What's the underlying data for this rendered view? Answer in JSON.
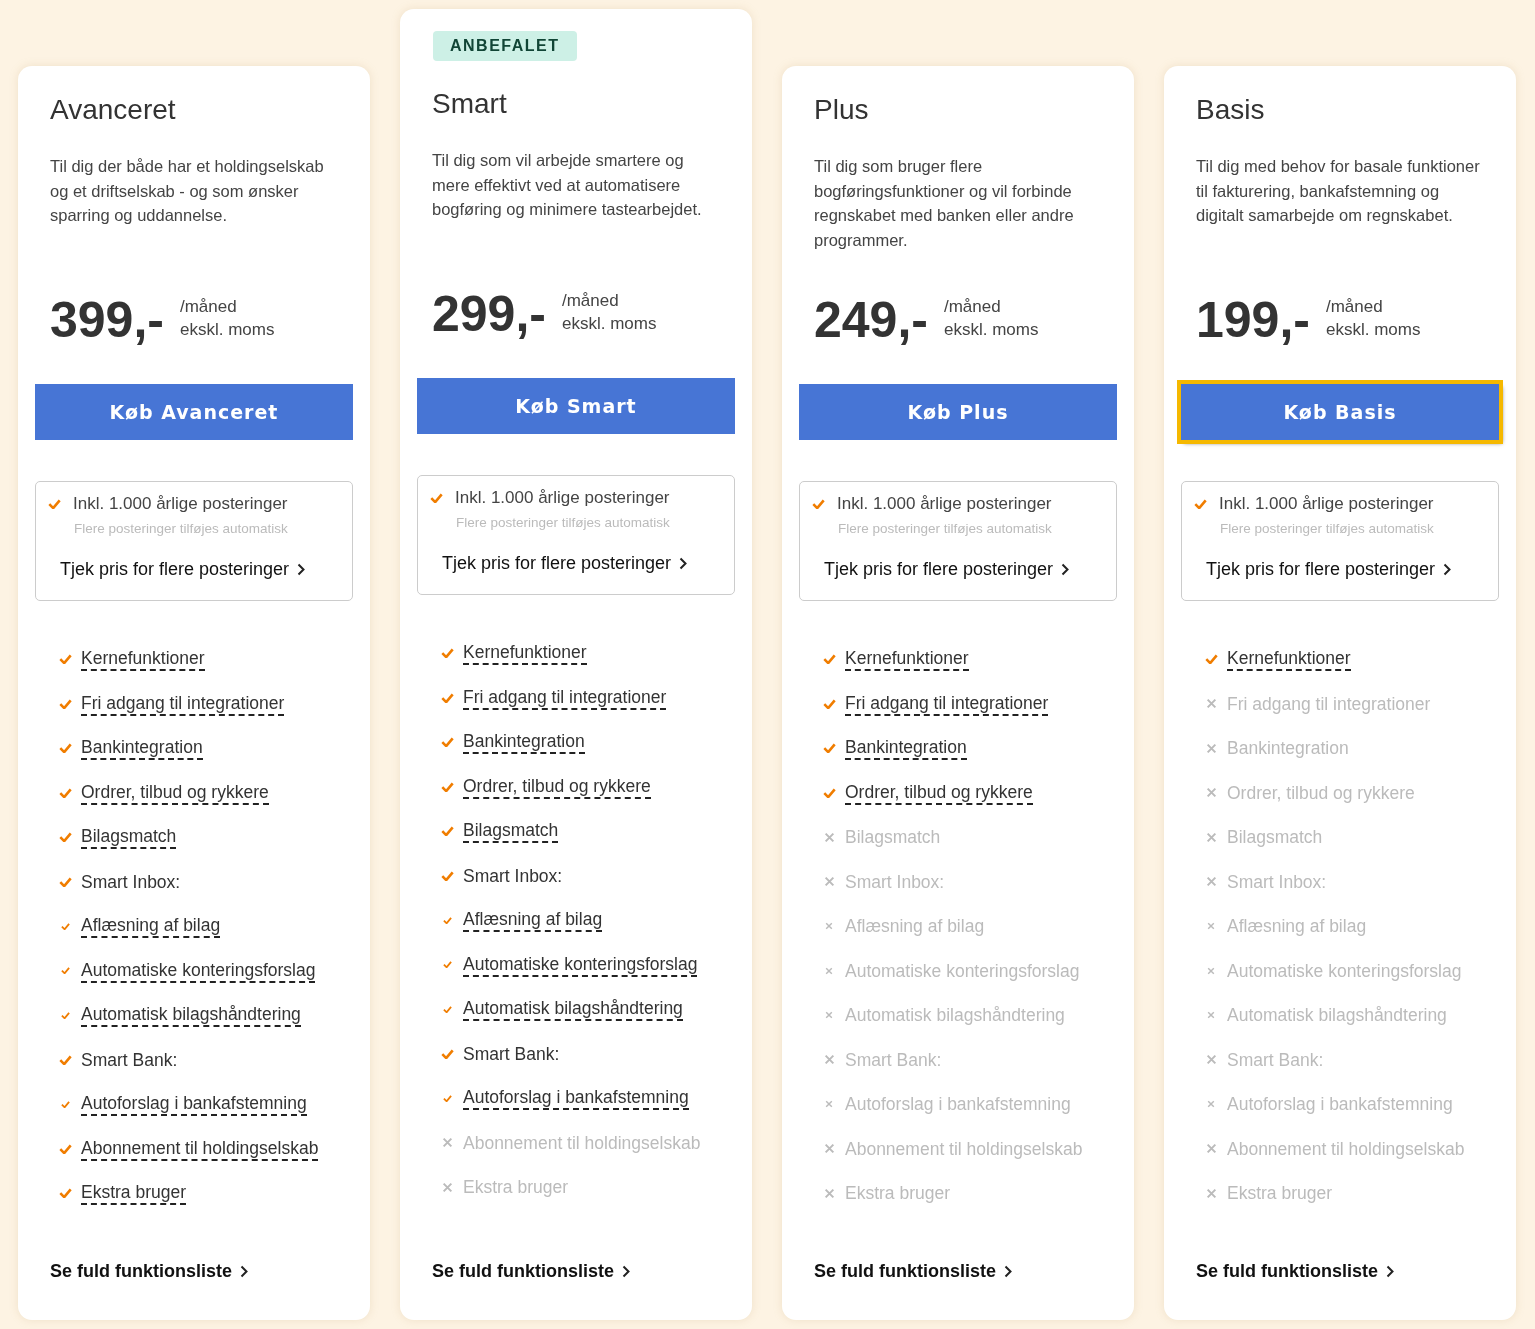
{
  "plans": [
    {
      "name": "Avanceret",
      "recommended": false,
      "description": "Til dig der både har et holdingselskab og et driftselskab - og som ønsker sparring og uddannelse.",
      "price": "399,-",
      "period": "/måned",
      "vat_note": "ekskl. moms",
      "buy_button": {
        "label": "Køb Avanceret",
        "focused": false
      },
      "postings": {
        "title": "Inkl. 1.000 årlige posteringer",
        "note": "Flere posteringer tilføjes automatisk",
        "link": "Tjek pris for flere posteringer"
      },
      "features": [
        {
          "label": "Kernefunktioner",
          "included": true,
          "tooltip": true
        },
        {
          "label": "Fri adgang til integrationer",
          "included": true,
          "tooltip": true
        },
        {
          "label": "Bankintegration",
          "included": true,
          "tooltip": true
        },
        {
          "label": "Ordrer, tilbud og rykkere",
          "included": true,
          "tooltip": true
        },
        {
          "label": "Bilagsmatch",
          "included": true,
          "tooltip": true
        },
        {
          "label": "Smart Inbox:",
          "included": true,
          "tooltip": false,
          "children": [
            {
              "label": "Aflæsning af bilag",
              "included": true,
              "tooltip": true
            },
            {
              "label": "Automatiske konteringsforslag",
              "included": true,
              "tooltip": true
            },
            {
              "label": "Automatisk bilagshåndtering",
              "included": true,
              "tooltip": true
            }
          ]
        },
        {
          "label": "Smart Bank:",
          "included": true,
          "tooltip": false,
          "children": [
            {
              "label": "Autoforslag i bankafstemning",
              "included": true,
              "tooltip": true
            }
          ]
        },
        {
          "label": "Abonnement til holdingselskab",
          "included": true,
          "tooltip": true
        },
        {
          "label": "Ekstra bruger",
          "included": true,
          "tooltip": true
        }
      ],
      "footer_link": "Se fuld funktionsliste"
    },
    {
      "name": "Smart",
      "recommended": true,
      "badge": "ANBEFALET",
      "description": "Til dig som vil arbejde smartere og mere effektivt ved at automatisere bogføring og minimere tastearbejdet.",
      "price": "299,-",
      "period": "/måned",
      "vat_note": "ekskl. moms",
      "buy_button": {
        "label": "Køb Smart",
        "focused": false
      },
      "postings": {
        "title": "Inkl. 1.000 årlige posteringer",
        "note": "Flere posteringer tilføjes automatisk",
        "link": "Tjek pris for flere posteringer"
      },
      "features": [
        {
          "label": "Kernefunktioner",
          "included": true,
          "tooltip": true
        },
        {
          "label": "Fri adgang til integrationer",
          "included": true,
          "tooltip": true
        },
        {
          "label": "Bankintegration",
          "included": true,
          "tooltip": true
        },
        {
          "label": "Ordrer, tilbud og rykkere",
          "included": true,
          "tooltip": true
        },
        {
          "label": "Bilagsmatch",
          "included": true,
          "tooltip": true
        },
        {
          "label": "Smart Inbox:",
          "included": true,
          "tooltip": false,
          "children": [
            {
              "label": "Aflæsning af bilag",
              "included": true,
              "tooltip": true
            },
            {
              "label": "Automatiske konteringsforslag",
              "included": true,
              "tooltip": true
            },
            {
              "label": "Automatisk bilagshåndtering",
              "included": true,
              "tooltip": true
            }
          ]
        },
        {
          "label": "Smart Bank:",
          "included": true,
          "tooltip": false,
          "children": [
            {
              "label": "Autoforslag i bankafstemning",
              "included": true,
              "tooltip": true
            }
          ]
        },
        {
          "label": "Abonnement til holdingselskab",
          "included": false,
          "tooltip": false
        },
        {
          "label": "Ekstra bruger",
          "included": false,
          "tooltip": false
        }
      ],
      "footer_link": "Se fuld funktionsliste"
    },
    {
      "name": "Plus",
      "recommended": false,
      "description": "Til dig som bruger flere bogføringsfunktioner og vil forbinde regnskabet med banken eller andre programmer.",
      "price": "249,-",
      "period": "/måned",
      "vat_note": "ekskl. moms",
      "buy_button": {
        "label": "Køb Plus",
        "focused": false
      },
      "postings": {
        "title": "Inkl. 1.000 årlige posteringer",
        "note": "Flere posteringer tilføjes automatisk",
        "link": "Tjek pris for flere posteringer"
      },
      "features": [
        {
          "label": "Kernefunktioner",
          "included": true,
          "tooltip": true
        },
        {
          "label": "Fri adgang til integrationer",
          "included": true,
          "tooltip": true
        },
        {
          "label": "Bankintegration",
          "included": true,
          "tooltip": true
        },
        {
          "label": "Ordrer, tilbud og rykkere",
          "included": true,
          "tooltip": true
        },
        {
          "label": "Bilagsmatch",
          "included": false,
          "tooltip": false
        },
        {
          "label": "Smart Inbox:",
          "included": false,
          "tooltip": false,
          "children": [
            {
              "label": "Aflæsning af bilag",
              "included": false,
              "tooltip": false
            },
            {
              "label": "Automatiske konteringsforslag",
              "included": false,
              "tooltip": false
            },
            {
              "label": "Automatisk bilagshåndtering",
              "included": false,
              "tooltip": false
            }
          ]
        },
        {
          "label": "Smart Bank:",
          "included": false,
          "tooltip": false,
          "children": [
            {
              "label": "Autoforslag i bankafstemning",
              "included": false,
              "tooltip": false
            }
          ]
        },
        {
          "label": "Abonnement til holdingselskab",
          "included": false,
          "tooltip": false
        },
        {
          "label": "Ekstra bruger",
          "included": false,
          "tooltip": false
        }
      ],
      "footer_link": "Se fuld funktionsliste"
    },
    {
      "name": "Basis",
      "recommended": false,
      "description": "Til dig med behov for basale funktioner til fakturering, bankafstemning og digitalt samarbejde om regnskabet.",
      "price": "199,-",
      "period": "/måned",
      "vat_note": "ekskl. moms",
      "buy_button": {
        "label": "Køb Basis",
        "focused": true
      },
      "postings": {
        "title": "Inkl. 1.000 årlige posteringer",
        "note": "Flere posteringer tilføjes automatisk",
        "link": "Tjek pris for flere posteringer"
      },
      "features": [
        {
          "label": "Kernefunktioner",
          "included": true,
          "tooltip": true
        },
        {
          "label": "Fri adgang til integrationer",
          "included": false,
          "tooltip": false
        },
        {
          "label": "Bankintegration",
          "included": false,
          "tooltip": false
        },
        {
          "label": "Ordrer, tilbud og rykkere",
          "included": false,
          "tooltip": false
        },
        {
          "label": "Bilagsmatch",
          "included": false,
          "tooltip": false
        },
        {
          "label": "Smart Inbox:",
          "included": false,
          "tooltip": false,
          "children": [
            {
              "label": "Aflæsning af bilag",
              "included": false,
              "tooltip": false
            },
            {
              "label": "Automatiske konteringsforslag",
              "included": false,
              "tooltip": false
            },
            {
              "label": "Automatisk bilagshåndtering",
              "included": false,
              "tooltip": false
            }
          ]
        },
        {
          "label": "Smart Bank:",
          "included": false,
          "tooltip": false,
          "children": [
            {
              "label": "Autoforslag i bankafstemning",
              "included": false,
              "tooltip": false
            }
          ]
        },
        {
          "label": "Abonnement til holdingselskab",
          "included": false,
          "tooltip": false
        },
        {
          "label": "Ekstra bruger",
          "included": false,
          "tooltip": false
        }
      ],
      "footer_link": "Se fuld funktionsliste"
    }
  ]
}
